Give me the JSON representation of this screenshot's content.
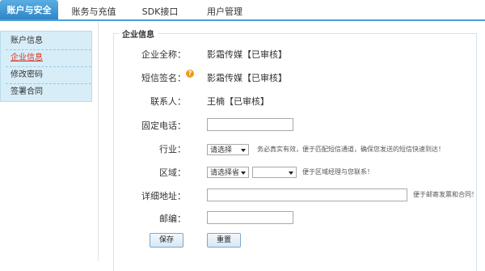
{
  "nav": {
    "tabs": [
      {
        "label": "账户与安全"
      },
      {
        "label": "账务与充值"
      },
      {
        "label": "SDK接口"
      },
      {
        "label": "用户管理"
      }
    ]
  },
  "sidebar": {
    "items": [
      {
        "label": "账户信息"
      },
      {
        "label": "企业信息"
      },
      {
        "label": "修改密码"
      },
      {
        "label": "签署合同"
      }
    ]
  },
  "panel": {
    "legend": "企业信息",
    "company_label": "企业全称：",
    "company_value": "影霜传媒【已审核】",
    "sign_label": "短信签名：",
    "sign_value": "影霜传媒【已审核】",
    "help_icon": "?",
    "contact_label": "联系人：",
    "contact_value": "王楠【已审核】",
    "phone_label": "固定电话：",
    "phone_value": "",
    "industry_label": "行业：",
    "industry_selected": "请选择",
    "industry_hint": "务必真实有效，便于匹配短信通道，确保您发送的短信快速到达！",
    "region_label": "区域：",
    "province_selected": "请选择省",
    "city_selected": "",
    "region_hint": "便于区域经理与您联系！",
    "address_label": "详细地址：",
    "address_value": "",
    "address_hint": "便于邮寄发票和合同！",
    "zip_label": "邮编：",
    "zip_value": "",
    "save_label": "保存",
    "reset_label": "重置"
  }
}
